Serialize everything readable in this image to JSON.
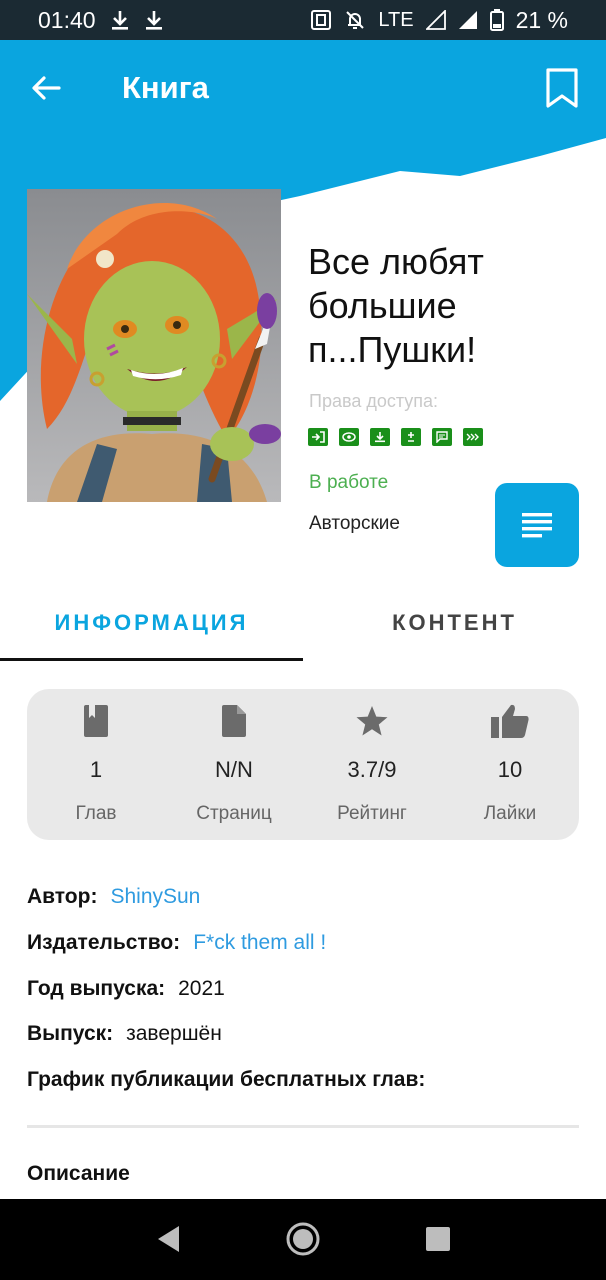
{
  "status_bar": {
    "time": "01:40",
    "network": "LTE",
    "battery": "21 %"
  },
  "app_bar": {
    "title": "Книга"
  },
  "book": {
    "title": "Все любят большие п...Пушки!",
    "access_label": "Права доступа:",
    "access_icons": [
      "enter-icon",
      "eye-icon",
      "download-icon",
      "plus-minus-icon",
      "comment-icon",
      "forward-icon"
    ],
    "status": "В работе",
    "rights": "Авторские"
  },
  "tabs": [
    {
      "label": "ИНФОРМАЦИЯ",
      "active": true
    },
    {
      "label": "КОНТЕНТ",
      "active": false
    }
  ],
  "stats": [
    {
      "icon": "book-icon",
      "value": "1",
      "label": "Глав"
    },
    {
      "icon": "page-icon",
      "value": "N/N",
      "label": "Страниц"
    },
    {
      "icon": "star-icon",
      "value": "3.7/9",
      "label": "Рейтинг"
    },
    {
      "icon": "thumb-up-icon",
      "value": "10",
      "label": "Лайки"
    }
  ],
  "info": {
    "author_key": "Автор:",
    "author_value": "ShinySun",
    "publisher_key": "Издательство:",
    "publisher_value": "F*ck them all !",
    "year_key": "Год выпуска:",
    "year_value": "2021",
    "release_key": "Выпуск:",
    "release_value": "завершён",
    "schedule_key": "График публикации бесплатных глав:"
  },
  "description_title": "Описание",
  "colors": {
    "accent": "#0aa5df",
    "status_green": "#4caf50",
    "link": "#2f9be0",
    "access_green": "#1a8f1a"
  }
}
